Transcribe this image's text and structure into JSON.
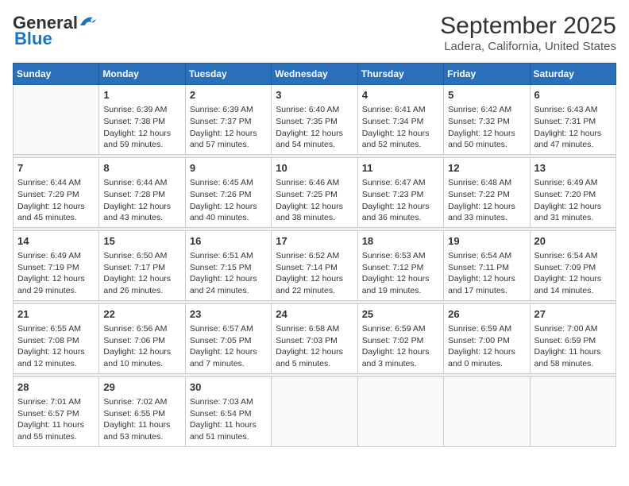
{
  "logo": {
    "general": "General",
    "blue": "Blue"
  },
  "title": "September 2025",
  "subtitle": "Ladera, California, United States",
  "days_of_week": [
    "Sunday",
    "Monday",
    "Tuesday",
    "Wednesday",
    "Thursday",
    "Friday",
    "Saturday"
  ],
  "weeks": [
    [
      {
        "day": "",
        "info": ""
      },
      {
        "day": "1",
        "info": "Sunrise: 6:39 AM\nSunset: 7:38 PM\nDaylight: 12 hours\nand 59 minutes."
      },
      {
        "day": "2",
        "info": "Sunrise: 6:39 AM\nSunset: 7:37 PM\nDaylight: 12 hours\nand 57 minutes."
      },
      {
        "day": "3",
        "info": "Sunrise: 6:40 AM\nSunset: 7:35 PM\nDaylight: 12 hours\nand 54 minutes."
      },
      {
        "day": "4",
        "info": "Sunrise: 6:41 AM\nSunset: 7:34 PM\nDaylight: 12 hours\nand 52 minutes."
      },
      {
        "day": "5",
        "info": "Sunrise: 6:42 AM\nSunset: 7:32 PM\nDaylight: 12 hours\nand 50 minutes."
      },
      {
        "day": "6",
        "info": "Sunrise: 6:43 AM\nSunset: 7:31 PM\nDaylight: 12 hours\nand 47 minutes."
      }
    ],
    [
      {
        "day": "7",
        "info": "Sunrise: 6:44 AM\nSunset: 7:29 PM\nDaylight: 12 hours\nand 45 minutes."
      },
      {
        "day": "8",
        "info": "Sunrise: 6:44 AM\nSunset: 7:28 PM\nDaylight: 12 hours\nand 43 minutes."
      },
      {
        "day": "9",
        "info": "Sunrise: 6:45 AM\nSunset: 7:26 PM\nDaylight: 12 hours\nand 40 minutes."
      },
      {
        "day": "10",
        "info": "Sunrise: 6:46 AM\nSunset: 7:25 PM\nDaylight: 12 hours\nand 38 minutes."
      },
      {
        "day": "11",
        "info": "Sunrise: 6:47 AM\nSunset: 7:23 PM\nDaylight: 12 hours\nand 36 minutes."
      },
      {
        "day": "12",
        "info": "Sunrise: 6:48 AM\nSunset: 7:22 PM\nDaylight: 12 hours\nand 33 minutes."
      },
      {
        "day": "13",
        "info": "Sunrise: 6:49 AM\nSunset: 7:20 PM\nDaylight: 12 hours\nand 31 minutes."
      }
    ],
    [
      {
        "day": "14",
        "info": "Sunrise: 6:49 AM\nSunset: 7:19 PM\nDaylight: 12 hours\nand 29 minutes."
      },
      {
        "day": "15",
        "info": "Sunrise: 6:50 AM\nSunset: 7:17 PM\nDaylight: 12 hours\nand 26 minutes."
      },
      {
        "day": "16",
        "info": "Sunrise: 6:51 AM\nSunset: 7:15 PM\nDaylight: 12 hours\nand 24 minutes."
      },
      {
        "day": "17",
        "info": "Sunrise: 6:52 AM\nSunset: 7:14 PM\nDaylight: 12 hours\nand 22 minutes."
      },
      {
        "day": "18",
        "info": "Sunrise: 6:53 AM\nSunset: 7:12 PM\nDaylight: 12 hours\nand 19 minutes."
      },
      {
        "day": "19",
        "info": "Sunrise: 6:54 AM\nSunset: 7:11 PM\nDaylight: 12 hours\nand 17 minutes."
      },
      {
        "day": "20",
        "info": "Sunrise: 6:54 AM\nSunset: 7:09 PM\nDaylight: 12 hours\nand 14 minutes."
      }
    ],
    [
      {
        "day": "21",
        "info": "Sunrise: 6:55 AM\nSunset: 7:08 PM\nDaylight: 12 hours\nand 12 minutes."
      },
      {
        "day": "22",
        "info": "Sunrise: 6:56 AM\nSunset: 7:06 PM\nDaylight: 12 hours\nand 10 minutes."
      },
      {
        "day": "23",
        "info": "Sunrise: 6:57 AM\nSunset: 7:05 PM\nDaylight: 12 hours\nand 7 minutes."
      },
      {
        "day": "24",
        "info": "Sunrise: 6:58 AM\nSunset: 7:03 PM\nDaylight: 12 hours\nand 5 minutes."
      },
      {
        "day": "25",
        "info": "Sunrise: 6:59 AM\nSunset: 7:02 PM\nDaylight: 12 hours\nand 3 minutes."
      },
      {
        "day": "26",
        "info": "Sunrise: 6:59 AM\nSunset: 7:00 PM\nDaylight: 12 hours\nand 0 minutes."
      },
      {
        "day": "27",
        "info": "Sunrise: 7:00 AM\nSunset: 6:59 PM\nDaylight: 11 hours\nand 58 minutes."
      }
    ],
    [
      {
        "day": "28",
        "info": "Sunrise: 7:01 AM\nSunset: 6:57 PM\nDaylight: 11 hours\nand 55 minutes."
      },
      {
        "day": "29",
        "info": "Sunrise: 7:02 AM\nSunset: 6:55 PM\nDaylight: 11 hours\nand 53 minutes."
      },
      {
        "day": "30",
        "info": "Sunrise: 7:03 AM\nSunset: 6:54 PM\nDaylight: 11 hours\nand 51 minutes."
      },
      {
        "day": "",
        "info": ""
      },
      {
        "day": "",
        "info": ""
      },
      {
        "day": "",
        "info": ""
      },
      {
        "day": "",
        "info": ""
      }
    ]
  ]
}
